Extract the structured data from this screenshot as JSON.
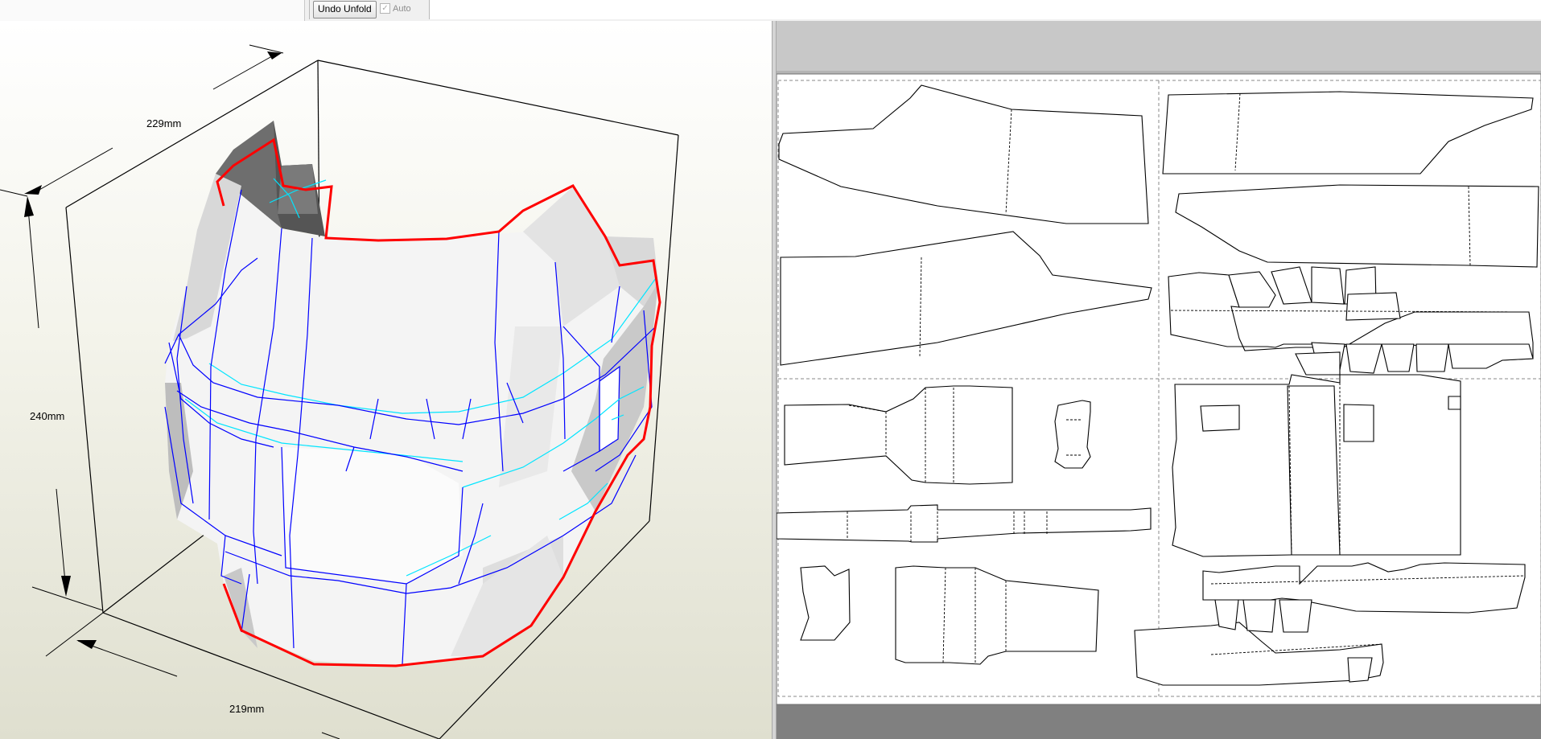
{
  "toolbar": {
    "undo_unfold_label": "Undo Unfold",
    "auto_label": "Auto",
    "auto_checked": true
  },
  "view3d": {
    "dimensions": {
      "depth": "229mm",
      "height": "240mm",
      "width": "219mm"
    },
    "colors": {
      "cut_edge": "#ff0000",
      "mountain_fold": "#0000ff",
      "valley_fold": "#00e5ff"
    }
  },
  "view2d": {
    "colors": {
      "page_border": "#808080",
      "paper": "#ffffff"
    }
  }
}
